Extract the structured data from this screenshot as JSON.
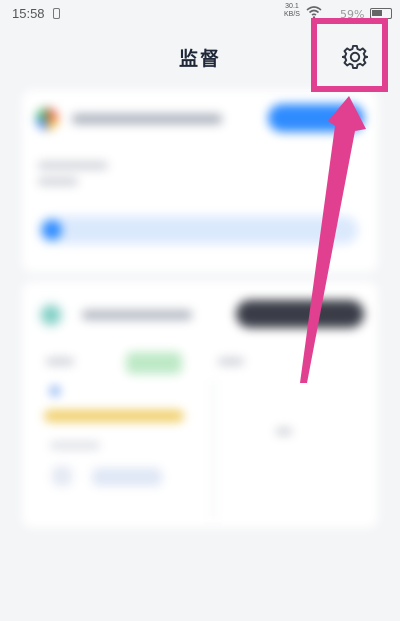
{
  "status_bar": {
    "time": "15:58",
    "net_speed_value": "30.1",
    "net_speed_unit": "KB/S",
    "battery_text": "59%"
  },
  "header": {
    "title": "监督",
    "settings_icon": "gear-icon"
  },
  "colors": {
    "annotation": "#e0408f",
    "accent_blue": "#2f8cff",
    "dark_button": "#3a3d48",
    "green_badge": "#5fcc72",
    "yellow_bar": "#f0cf6a"
  }
}
